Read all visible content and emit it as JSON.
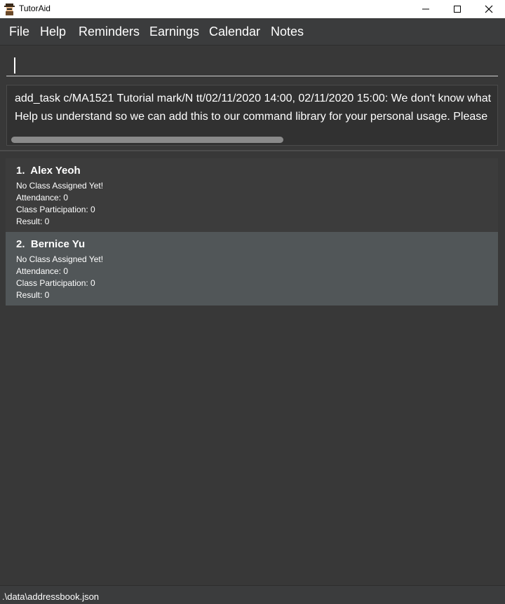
{
  "window": {
    "title": "TutorAid",
    "icon": "app-logo-icon",
    "controls": [
      "minimize-icon",
      "maximize-icon",
      "close-icon"
    ]
  },
  "menu": {
    "items": [
      "File",
      "Help",
      "Reminders",
      "Earnings",
      "Calendar",
      "Notes"
    ]
  },
  "command": {
    "value": ""
  },
  "result": {
    "line1": "add_task c/MA1521 Tutorial mark/N tt/02/11/2020 14:00, 02/11/2020 15:00: We don't know what",
    "line2": "Help us understand so we can add this to our command library for your personal usage. Please"
  },
  "students": [
    {
      "index": "1.",
      "name": "Alex Yeoh",
      "class": "No Class Assigned Yet!",
      "attendance": "Attendance: 0",
      "participation": "Class Participation: 0",
      "result": "Result: 0"
    },
    {
      "index": "2.",
      "name": "Bernice Yu",
      "class": "No Class Assigned Yet!",
      "attendance": "Attendance: 0",
      "participation": "Class Participation: 0",
      "result": "Result: 0"
    }
  ],
  "status": {
    "path": ".\\data\\addressbook.json"
  }
}
